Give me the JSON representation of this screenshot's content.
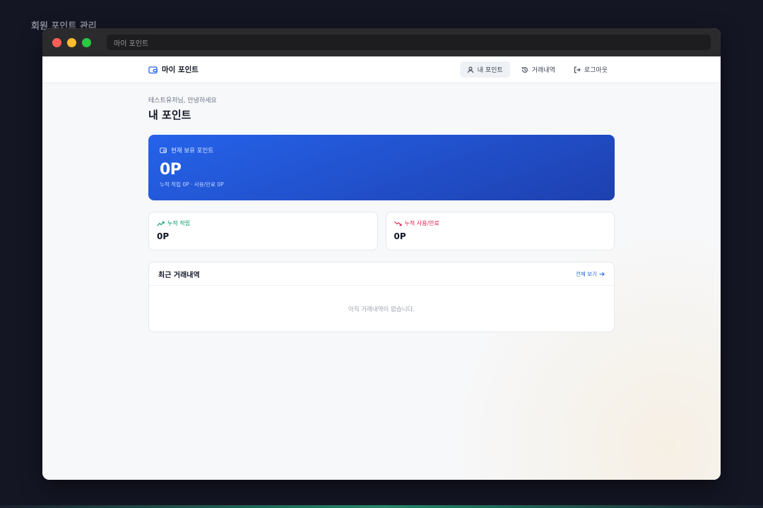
{
  "page": {
    "caption": "회원 포인트 관리"
  },
  "browser": {
    "address": "마이 포인트"
  },
  "nav": {
    "brand": "마이 포인트",
    "links": [
      {
        "label": "내 포인트",
        "icon": "user-icon",
        "active": true
      },
      {
        "label": "거래내역",
        "icon": "history-icon",
        "active": false
      },
      {
        "label": "로그아웃",
        "icon": "logout-icon",
        "active": false
      }
    ]
  },
  "main": {
    "greeting": "테스트유저님, 안녕하세요",
    "title": "내 포인트",
    "balance": {
      "label": "현재 보유 포인트",
      "value": "0P",
      "sub": "누적 적립 0P · 사용/만료 0P"
    },
    "stats": [
      {
        "label": "누적 적립",
        "value": "0P",
        "icon": "trending-up-icon",
        "color": "#059669"
      },
      {
        "label": "누적 사용/만료",
        "value": "0P",
        "icon": "trending-down-icon",
        "color": "#e11d48"
      }
    ],
    "recent": {
      "title": "최근 거래내역",
      "view_all": "전체 보기",
      "empty": "아직 거래내역이 없습니다."
    }
  },
  "colors": {
    "accent": "#2563eb",
    "card_gradient_end": "#1e40af"
  }
}
